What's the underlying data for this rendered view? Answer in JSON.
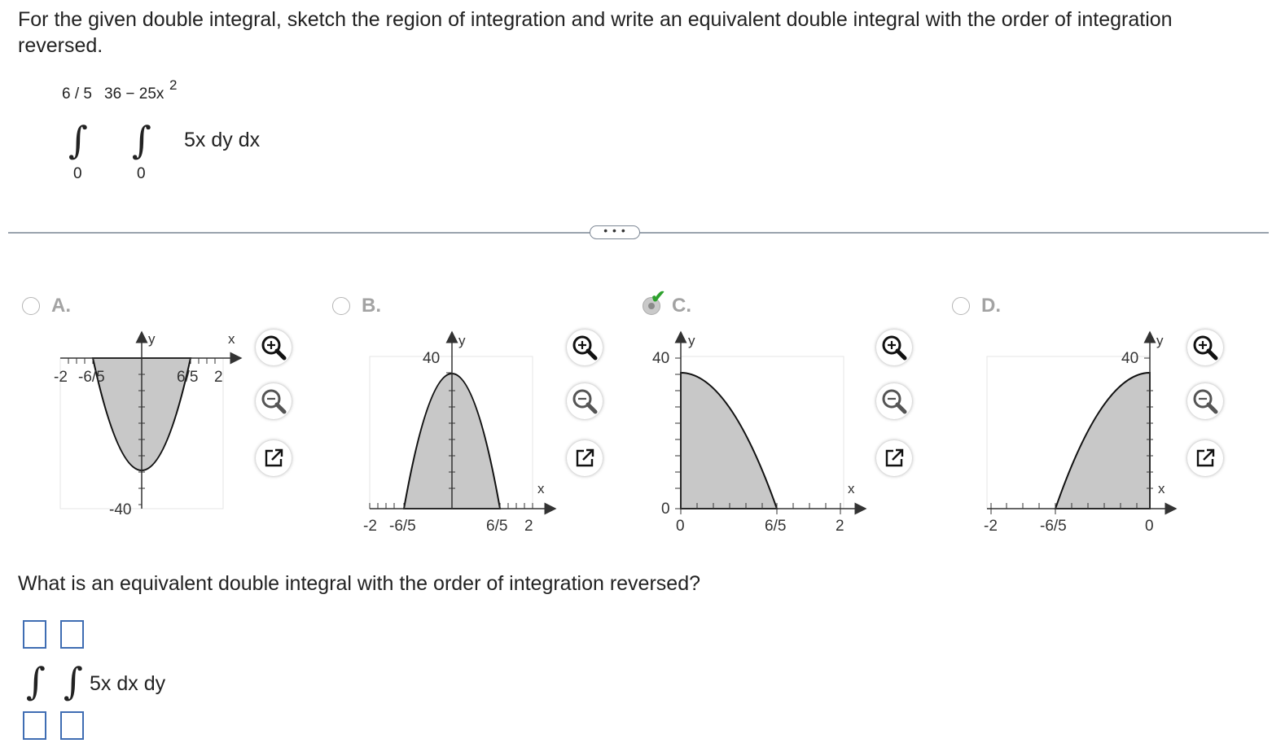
{
  "question": {
    "text": "For the given double integral, sketch the region of integration and write an equivalent double integral with the order of integration reversed."
  },
  "given_integral": {
    "outer_upper": "6 / 5",
    "outer_lower": "0",
    "inner_upper": "36 − 25x",
    "inner_upper_exponent": "2",
    "inner_lower": "0",
    "integrand": "5x dy dx"
  },
  "more_button": {
    "label": "• • •"
  },
  "options": [
    {
      "id": "A",
      "label": "A.",
      "selected": false,
      "x_ticks": [
        "-2",
        "-6/5",
        "6/5",
        "2"
      ],
      "y_ticks": [
        "-40"
      ],
      "x_axis_label": "x",
      "y_axis_label": "y"
    },
    {
      "id": "B",
      "label": "B.",
      "selected": false,
      "x_ticks": [
        "-2",
        "-6/5",
        "6/5",
        "2"
      ],
      "y_ticks": [
        "40"
      ],
      "x_axis_label": "x",
      "y_axis_label": "y"
    },
    {
      "id": "C",
      "label": "C.",
      "selected": true,
      "x_ticks": [
        "0",
        "6/5",
        "2"
      ],
      "y_ticks": [
        "40",
        "0"
      ],
      "x_axis_label": "x",
      "y_axis_label": "y"
    },
    {
      "id": "D",
      "label": "D.",
      "selected": false,
      "x_ticks": [
        "-2",
        "-6/5",
        "0"
      ],
      "y_ticks": [
        "40"
      ],
      "x_axis_label": "x",
      "y_axis_label": "y"
    }
  ],
  "selected_mark": "✔",
  "tools": [
    "zoom-in-icon",
    "zoom-out-icon",
    "open-new-window-icon"
  ],
  "question2": {
    "text": "What is an equivalent double integral with the order of integration reversed?"
  },
  "answer_template": {
    "integrand": "5x dx dy"
  },
  "colors": {
    "region_fill": "#c8c8c8",
    "answer_box_border": "#3f6db3",
    "check": "#2ea12e"
  }
}
